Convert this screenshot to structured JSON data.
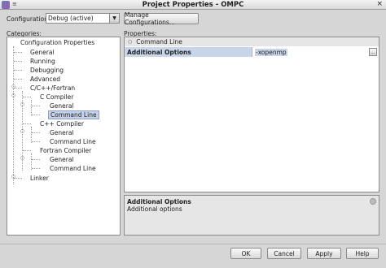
{
  "window": {
    "title": "Project Properties - OMPC",
    "menu_glyph": "≡",
    "close_glyph": "×"
  },
  "config": {
    "label": "Configuration:",
    "selected": "Debug (active)",
    "manage_label": "Manage Configurations..."
  },
  "categories": {
    "label": "Categories:",
    "items": [
      {
        "label": "Configuration Properties"
      },
      {
        "label": "General"
      },
      {
        "label": "Running"
      },
      {
        "label": "Debugging"
      },
      {
        "label": "Advanced"
      },
      {
        "label": "C/C++/Fortran"
      },
      {
        "label": "C Compiler"
      },
      {
        "label": "General"
      },
      {
        "label": "Command Line"
      },
      {
        "label": "C++ Compiler"
      },
      {
        "label": "General"
      },
      {
        "label": "Command Line"
      },
      {
        "label": "Fortran Compiler"
      },
      {
        "label": "General"
      },
      {
        "label": "Command Line"
      },
      {
        "label": "Linker"
      }
    ]
  },
  "properties": {
    "label": "Properties:",
    "group": "Command Line",
    "row": {
      "name": "Additional Options",
      "value": "-xopenmp",
      "button": "..."
    }
  },
  "description": {
    "title": "Additional Options",
    "text": "Additional options"
  },
  "buttons": {
    "ok": "OK",
    "cancel": "Cancel",
    "apply": "Apply",
    "help": "Help"
  }
}
